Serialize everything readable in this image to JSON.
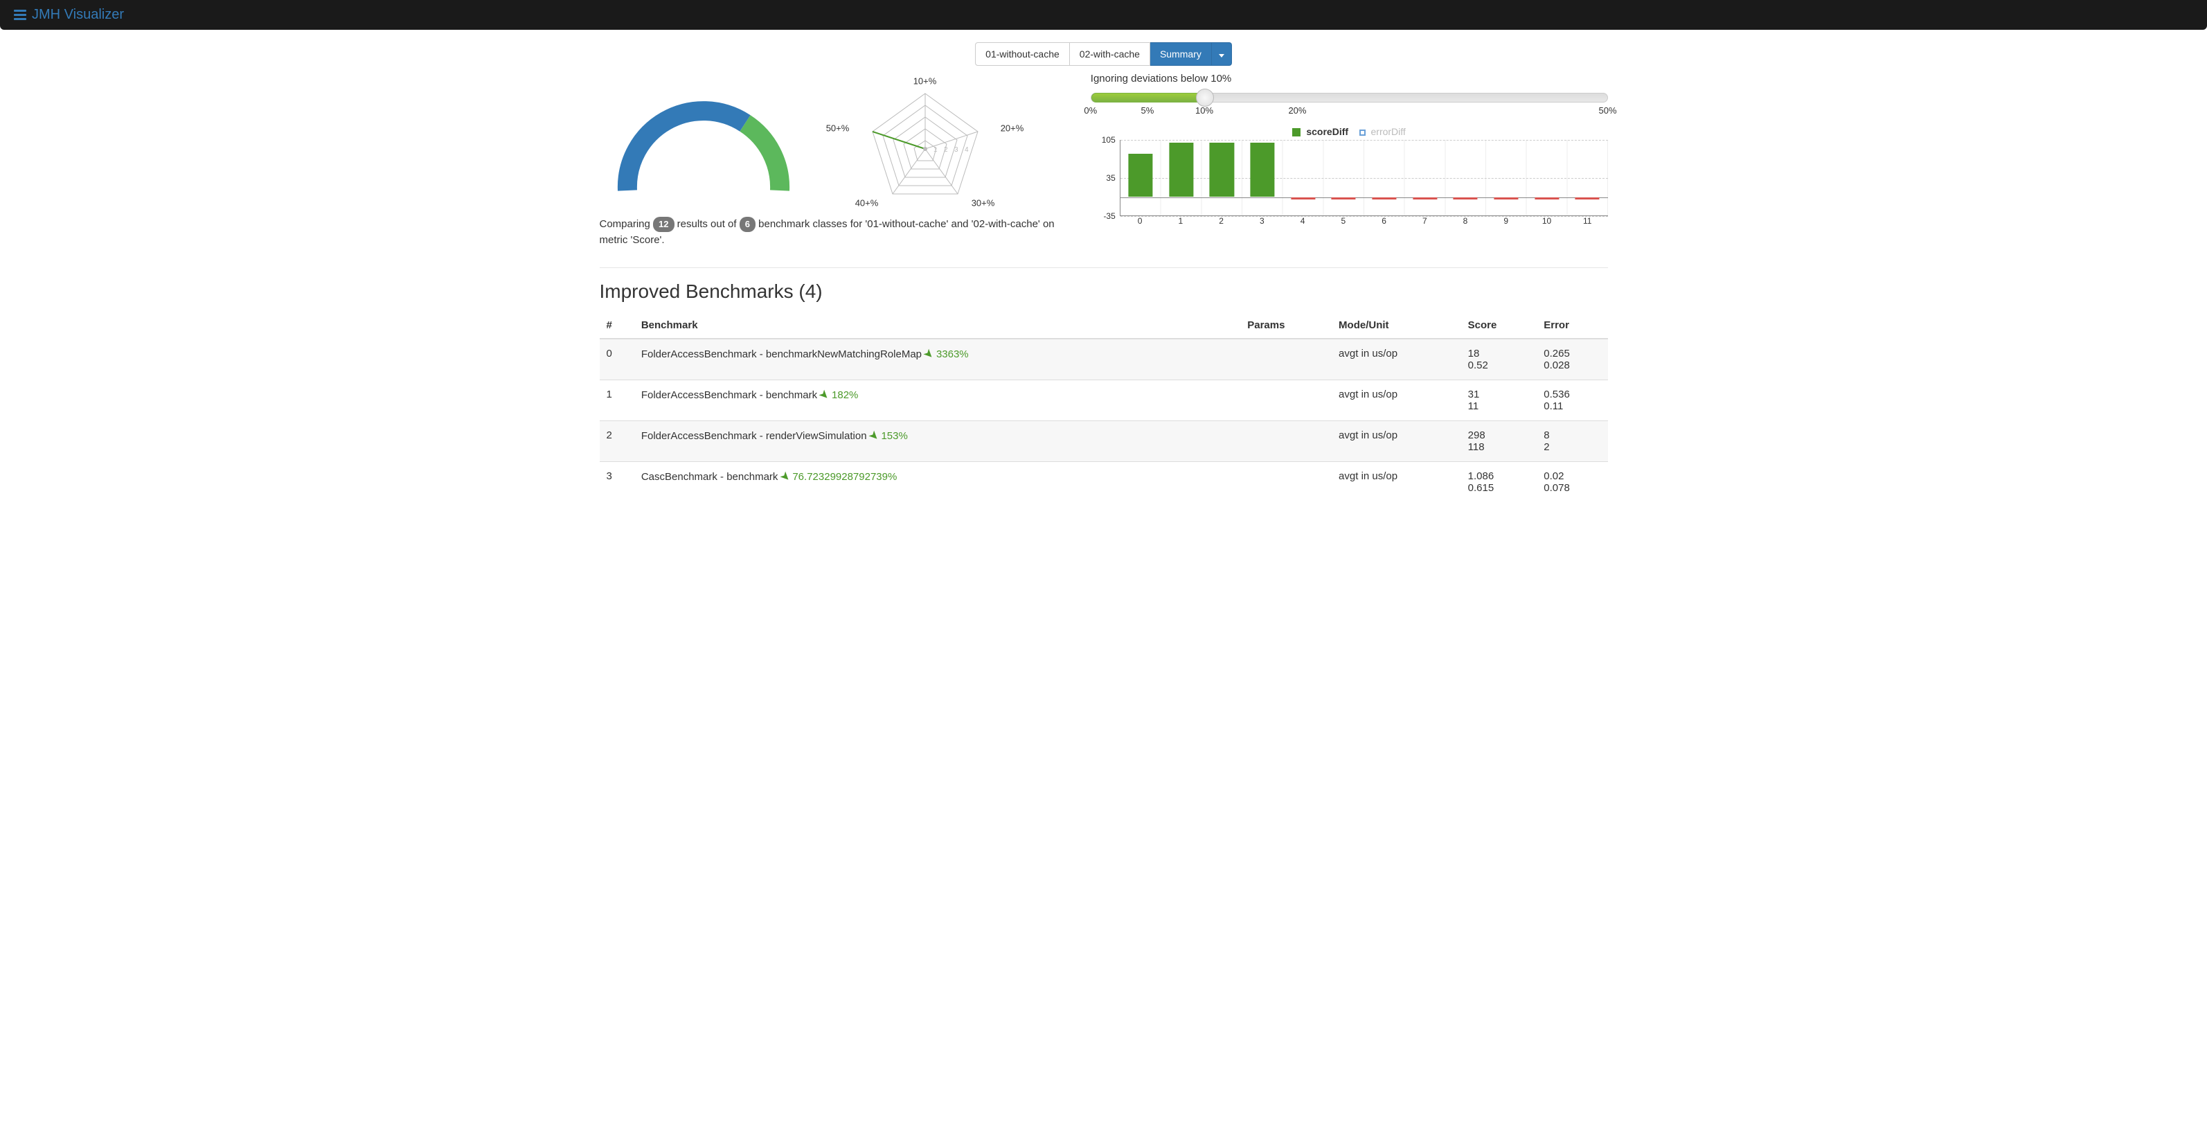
{
  "header": {
    "brand": "JMH Visualizer"
  },
  "tabs": {
    "items": [
      "01-without-cache",
      "02-with-cache",
      "Summary"
    ],
    "active": 2
  },
  "radar": {
    "labels": [
      "10+%",
      "20+%",
      "30+%",
      "40+%",
      "50+%"
    ],
    "tick_labels": [
      "1",
      "2",
      "3",
      "4"
    ]
  },
  "summary_text": {
    "prefix": "Comparing ",
    "count1": "12",
    "mid1": " results out of ",
    "count2": "6",
    "suffix": " benchmark classes for '01-without-cache' and '02-with-cache' on metric 'Score'."
  },
  "slider": {
    "label": "Ignoring deviations below 10%",
    "value_pct": 22,
    "ticks": [
      {
        "label": "0%",
        "pos": 0
      },
      {
        "label": "5%",
        "pos": 11
      },
      {
        "label": "10%",
        "pos": 22
      },
      {
        "label": "20%",
        "pos": 40
      },
      {
        "label": "50%",
        "pos": 100
      }
    ]
  },
  "diff_chart": {
    "legend": {
      "a": "scoreDiff",
      "b": "errorDiff"
    }
  },
  "chart_data": {
    "type": "bar",
    "title": "",
    "xlabel": "",
    "ylabel": "",
    "ylim": [
      -35,
      105
    ],
    "yticks": [
      -35,
      35,
      105
    ],
    "categories": [
      "0",
      "1",
      "2",
      "3",
      "4",
      "5",
      "6",
      "7",
      "8",
      "9",
      "10",
      "11"
    ],
    "series": [
      {
        "name": "scoreDiff",
        "color": "#4c9a2a",
        "values": [
          80,
          100,
          100,
          100,
          0,
          0,
          0,
          0,
          0,
          0,
          0,
          0
        ]
      },
      {
        "name": "errorDiff",
        "color": "#d9534f",
        "values": [
          0,
          0,
          0,
          0,
          -5,
          -5,
          -5,
          -5,
          -5,
          -5,
          -5,
          -5
        ]
      }
    ]
  },
  "section": {
    "title": "Improved Benchmarks (4)"
  },
  "table": {
    "headers": [
      "#",
      "Benchmark",
      "Params",
      "Mode/Unit",
      "Score",
      "Error"
    ],
    "rows": [
      {
        "idx": "0",
        "name": "FolderAccessBenchmark - benchmarkNewMatchingRoleMap",
        "pct": "3363%",
        "params": "",
        "mode": "avgt in us/op",
        "score1": "18",
        "score2": "0.52",
        "err1": "0.265",
        "err2": "0.028"
      },
      {
        "idx": "1",
        "name": "FolderAccessBenchmark - benchmark",
        "pct": "182%",
        "params": "",
        "mode": "avgt in us/op",
        "score1": "31",
        "score2": "11",
        "err1": "0.536",
        "err2": "0.11"
      },
      {
        "idx": "2",
        "name": "FolderAccessBenchmark - renderViewSimulation",
        "pct": "153%",
        "params": "",
        "mode": "avgt in us/op",
        "score1": "298",
        "score2": "118",
        "err1": "8",
        "err2": "2"
      },
      {
        "idx": "3",
        "name": "CascBenchmark - benchmark",
        "pct": "76.72329928792739%",
        "params": "",
        "mode": "avgt in us/op",
        "score1": "1.086",
        "score2": "0.615",
        "err1": "0.02",
        "err2": "0.078"
      }
    ]
  }
}
